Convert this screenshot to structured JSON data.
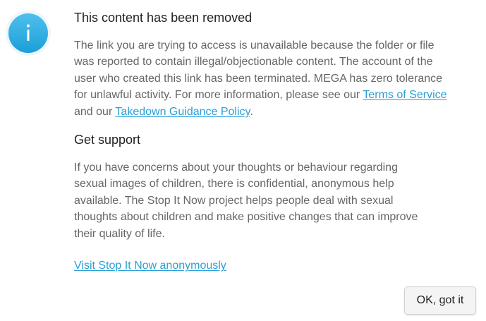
{
  "dialog": {
    "title": "This content has been removed",
    "body": {
      "text_before_terms": "The link you are trying to access is unavailable because the folder or file was reported to contain illegal/objectionable content. The account of the user who created this link has been terminated. MEGA has zero tolerance for unlawful activity. For more information, please see our ",
      "terms_link": "Terms of Service",
      "text_between": " and our ",
      "takedown_link": "Takedown Guidance Policy",
      "text_after": "."
    },
    "support_heading": "Get support",
    "support_text": "If you have concerns about your thoughts or behaviour regarding sexual images of children, there is confidential, anonymous help available. The Stop It Now project helps people deal with sexual thoughts about children and make positive changes that can improve their quality of life.",
    "support_link": "Visit Stop It Now anonymously",
    "ok_button": "OK, got it",
    "icon": "info-icon"
  },
  "colors": {
    "accent": "#2a9fd6",
    "icon_blue": "#1a9fd9",
    "heading": "#222222",
    "body_text": "#666666"
  }
}
